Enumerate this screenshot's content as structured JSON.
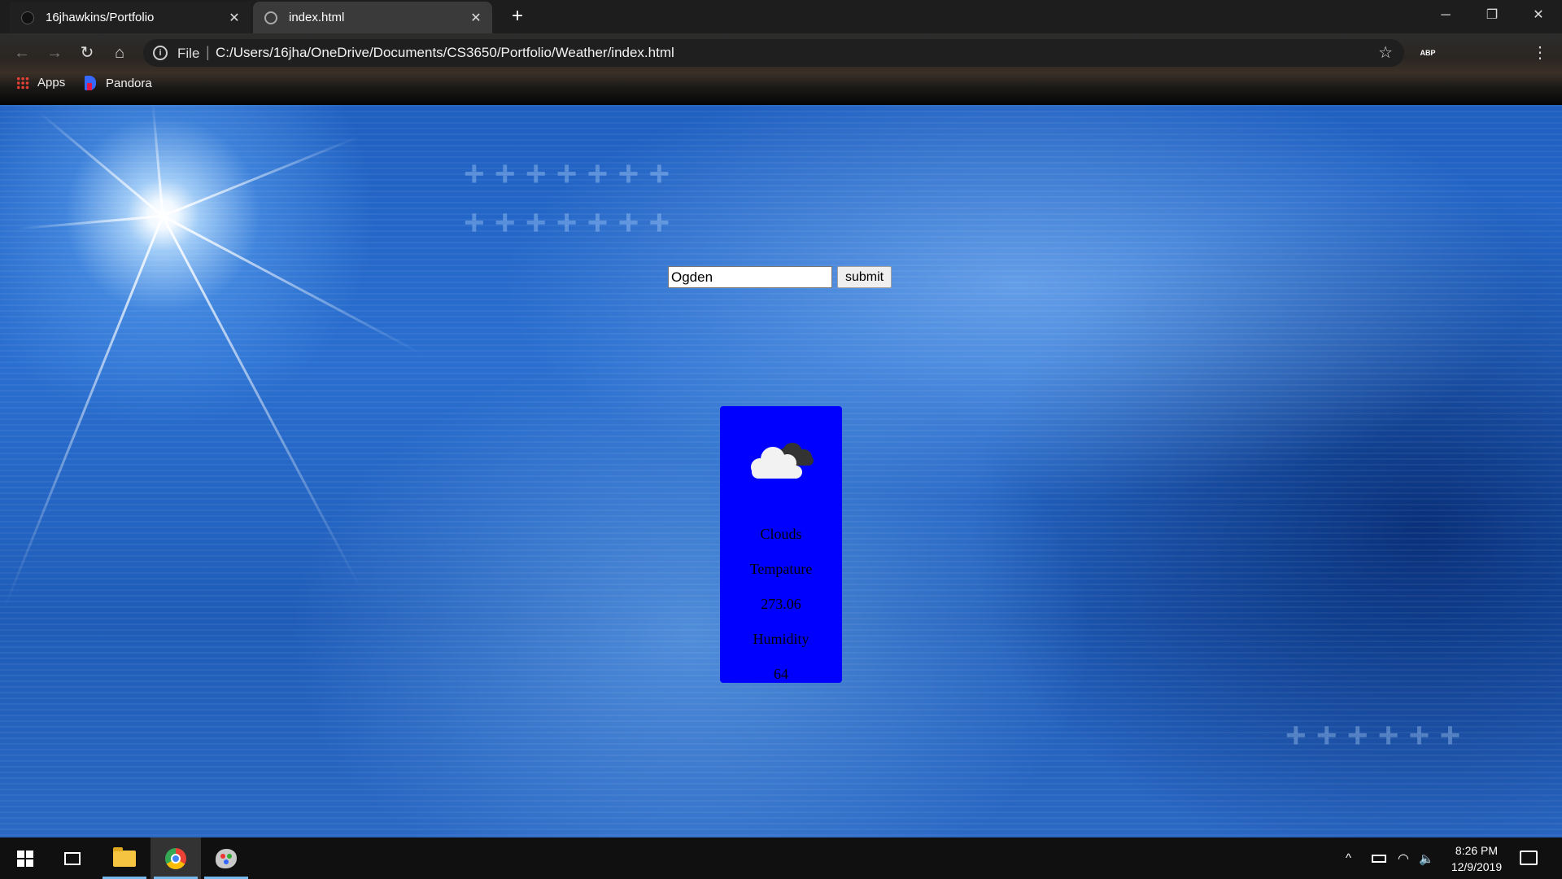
{
  "browser": {
    "tabs": [
      {
        "title": "16jhawkins/Portfolio",
        "close": "✕"
      },
      {
        "title": "index.html",
        "close": "✕"
      }
    ],
    "new_tab": "+",
    "window_controls": {
      "minimize": "─",
      "restore": "❐",
      "close": "✕"
    },
    "nav": {
      "back": "←",
      "forward": "→",
      "reload": "↻",
      "home": "⌂"
    },
    "address_bar": {
      "scheme": "File",
      "separator": "|",
      "url": "C:/Users/16jha/OneDrive/Documents/CS3650/Portfolio/Weather/index.html",
      "bookmark_star": "☆"
    },
    "extensions": [
      {
        "name": "adblock-plus-icon",
        "label": "ABP",
        "color": "#d9232d"
      },
      {
        "name": "extension-icon",
        "label": "",
        "color": "#f5a623"
      },
      {
        "name": "profile-avatar",
        "label": "",
        "color": "#7ac943"
      }
    ],
    "menu": "⋮",
    "bookmarks": [
      {
        "label": "Apps"
      },
      {
        "label": "Pandora"
      }
    ]
  },
  "page": {
    "search": {
      "value": "Ogden",
      "submit_label": "submit"
    },
    "weather_card": {
      "color": "#0000ff",
      "icon": "clouds-icon",
      "condition": "Clouds",
      "temperature_label": "Tempature",
      "temperature_value": "273.06",
      "humidity_label": "Humidity",
      "humidity_value": "64"
    }
  },
  "taskbar": {
    "pinned": [
      "start-button",
      "task-view-button",
      "file-explorer-icon",
      "chrome-icon",
      "paint-icon"
    ],
    "tray": {
      "chevron": "^",
      "volume": "🔈"
    },
    "clock": {
      "time": "8:26 PM",
      "date": "12/9/2019"
    }
  }
}
